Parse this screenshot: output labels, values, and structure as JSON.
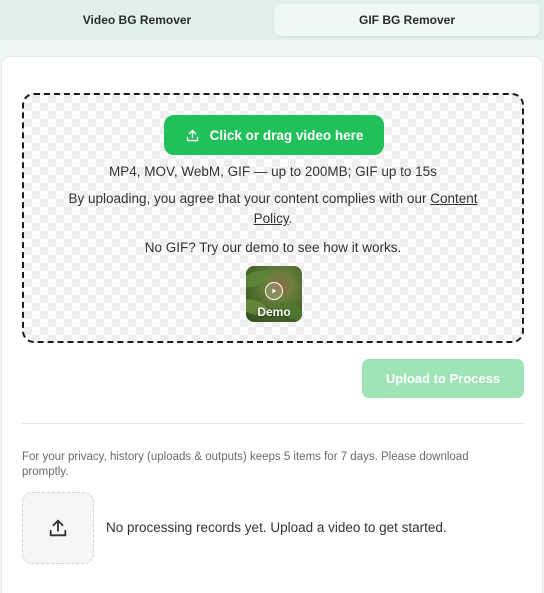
{
  "tabs": [
    {
      "label": "Video BG Remover",
      "active": false
    },
    {
      "label": "GIF BG Remover",
      "active": true
    }
  ],
  "dropzone": {
    "button_label": "Click or drag video here",
    "button_icon": "upload-icon",
    "formats": "MP4, MOV, WebM, GIF — up to 200MB; GIF up to 15s",
    "agree_prefix": "By uploading, you agree that your content complies with our",
    "policy_link_part1": "Content",
    "policy_link_part2": "Policy",
    "agree_suffix": ".",
    "demo_prompt": "No GIF? Try our demo to see how it works.",
    "demo_label": "Demo"
  },
  "actions": {
    "upload_process_label": "Upload to Process"
  },
  "history": {
    "privacy_note": "For your privacy, history (uploads & outputs) keeps 5 items for 7 days. Please download promptly.",
    "empty_message": "No processing records yet. Upload a video to get started.",
    "upload_icon": "upload-icon"
  },
  "colors": {
    "primary": "#22c05a",
    "primary_disabled": "#9ee4b7",
    "tab_bar": "#e1f1ea",
    "active_tab": "#eef8f6"
  }
}
